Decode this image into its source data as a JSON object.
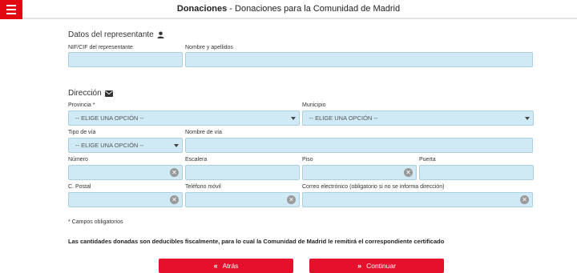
{
  "header": {
    "title_bold": "Donaciones",
    "title_rest": " - Donaciones para la Comunidad de Madrid"
  },
  "representante": {
    "section_title": "Datos del representante",
    "nif_label": "NIF/CIF del representante",
    "nombre_label": "Nombre y apellidos"
  },
  "direccion": {
    "section_title": "Dirección",
    "provincia_label": "Provincia *",
    "provincia_value": "-- ELIGE UNA OPCIÓN --",
    "municipio_label": "Municipio",
    "municipio_value": "-- ELIGE UNA OPCIÓN --",
    "tipo_via_label": "Tipo de vía",
    "tipo_via_value": "-- ELIGE UNA OPCIÓN --",
    "nombre_via_label": "Nombre de vía",
    "numero_label": "Número",
    "escalera_label": "Escalera",
    "piso_label": "Piso",
    "puerta_label": "Puerta",
    "cp_label": "C. Postal",
    "telefono_label": "Teléfono móvil",
    "correo_label": "Correo electrónico (obligatorio si no se informa dirección)"
  },
  "required_note": "* Campos obligatorios",
  "info_text": "Las cantidades donadas son deducibles fiscalmente, para lo cual la Comunidad de Madrid le remitirá el correspondiente certificado",
  "buttons": {
    "back": "Atrás",
    "continue": "Continuar"
  },
  "icons": {
    "menu": "hamburger-menu-icon",
    "user": "user-icon",
    "envelope": "envelope-icon",
    "clear": "clear-icon",
    "caret": "caret-down-icon"
  },
  "colors": {
    "accent": "#e5102b",
    "field_bg": "#cfe9f5"
  }
}
